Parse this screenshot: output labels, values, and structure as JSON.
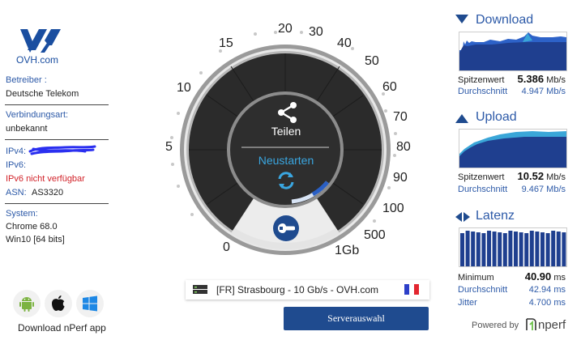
{
  "logo": {
    "brand": "OVH.com"
  },
  "isp": {
    "label": "Betreiber :",
    "value": "Deutsche Telekom"
  },
  "connection": {
    "label": "Verbindungsart:",
    "value": "unbekannt"
  },
  "network": {
    "ipv4_label": "IPv4:",
    "ipv6_label": "IPv6:",
    "ipv6_status": "IPv6 nicht verfügbar",
    "asn_label": "ASN:",
    "asn_value": "AS3320"
  },
  "system": {
    "label": "System:",
    "browser": "Chrome 68.0",
    "os": "Win10 [64 bits]"
  },
  "apps": {
    "label": "Download nPerf app",
    "icons": [
      "android-icon",
      "apple-icon",
      "windows-icon"
    ]
  },
  "gauge": {
    "ticks": [
      "0",
      "5",
      "10",
      "15",
      "20",
      "30",
      "40",
      "50",
      "60",
      "70",
      "80",
      "90",
      "100",
      "500",
      "1Gb"
    ],
    "share_label": "Teilen",
    "restart_label": "Neustarten"
  },
  "server": {
    "name": "[FR] Strasbourg - 10 Gb/s - OVH.com",
    "country": "France"
  },
  "server_select_label": "Serverauswahl",
  "download": {
    "title": "Download",
    "peak_label": "Spitzenwert",
    "peak_value": "5.386",
    "peak_unit": "Mb/s",
    "avg_label": "Durchschnitt",
    "avg_value": "4.947 Mb/s"
  },
  "upload": {
    "title": "Upload",
    "peak_label": "Spitzenwert",
    "peak_value": "10.52",
    "peak_unit": "Mb/s",
    "avg_label": "Durchschnitt",
    "avg_value": "9.467 Mb/s"
  },
  "latency": {
    "title": "Latenz",
    "min_label": "Minimum",
    "min_value": "40.90",
    "min_unit": "ms",
    "avg_label": "Durchschnitt",
    "avg_value": "42.94 ms",
    "jitter_label": "Jitter",
    "jitter_value": "4.700 ms"
  },
  "footer": {
    "powered_label": "Powered by",
    "brand": "nperf"
  },
  "colors": {
    "accent": "#2d5aa8",
    "graph_fill": "#1f3f8f",
    "graph_light": "#3aa6d8",
    "dark": "#2a2a2a",
    "error": "#d2232a"
  }
}
